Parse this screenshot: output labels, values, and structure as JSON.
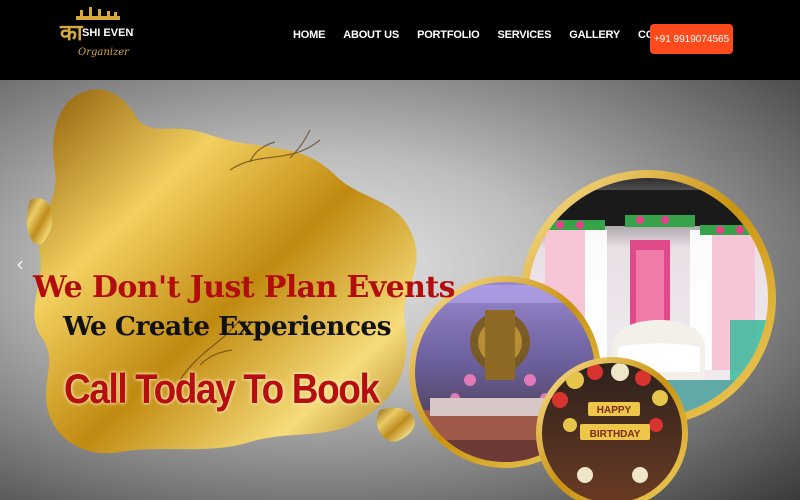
{
  "brand": {
    "logo_text_line1": "का SHI EVENT",
    "logo_text_line2": "Organizer"
  },
  "nav": {
    "items": [
      "HOME",
      "ABOUT US",
      "PORTFOLIO",
      "SERVICES",
      "GALLERY",
      "CONTACT US"
    ]
  },
  "header": {
    "phone": "+91 9919074565"
  },
  "hero": {
    "headline": "We Don't Just Plan Events",
    "subline": "We Create Experiences",
    "cta": "Call Today To Book",
    "prev_icon": "‹"
  },
  "photos": {
    "birthday_sign_line1": "HAPPY",
    "birthday_sign_line2": "BIRTHDAY"
  },
  "colors": {
    "accent": "#ff4a1c",
    "headline": "#b10d0d",
    "gold": "#d4a017"
  }
}
